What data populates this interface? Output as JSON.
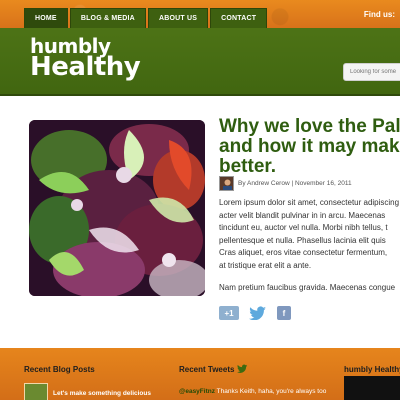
{
  "nav": {
    "items": [
      {
        "label": "HOME",
        "active": true
      },
      {
        "label": "BLOG & MEDIA",
        "active": false
      },
      {
        "label": "ABOUT US",
        "active": false
      },
      {
        "label": "CONTACT",
        "active": false
      }
    ],
    "find_us": "Find us:"
  },
  "logo": {
    "line1": "humbly",
    "line2": "Healthy"
  },
  "search": {
    "placeholder": "Looking for something?"
  },
  "article": {
    "title_lines": [
      "Why we love the Pale",
      "and how it may make",
      "better."
    ],
    "meta": "By Andrew Cerow | November 16, 2011",
    "paragraph1_lines": [
      "Lorem ipsum dolor sit amet, consectetur adipiscing",
      "acter velit blandit pulvinar in in arcu. Maecenas",
      "tincidunt eu, auctor vel nulla. Morbi nibh tellus, t",
      "pellentesque et nulla. Phasellus lacinia elit quis",
      "Cras aliquet, eros vitae consectetur fermentum,",
      "at tristique erat elit a ante."
    ],
    "paragraph2_lines": [
      "Nam pretium faucibus gravida. Maecenas congue"
    ],
    "share": {
      "gplus": "+1",
      "twitter": "twitter-icon",
      "facebook": "f"
    }
  },
  "footer": {
    "recent_posts_title": "Recent Blog Posts",
    "recent_post_1": "Let's make something delicious",
    "recent_tweets_title": "Recent Tweets",
    "tweet_handle": "@easyFitnz",
    "tweet_text": "Thanks Keith, haha, you're always too",
    "third_title": "humbly Healthy"
  },
  "colors": {
    "orange": "#e98a1e",
    "green": "#4d7316",
    "dark_green": "#2f5d10"
  }
}
